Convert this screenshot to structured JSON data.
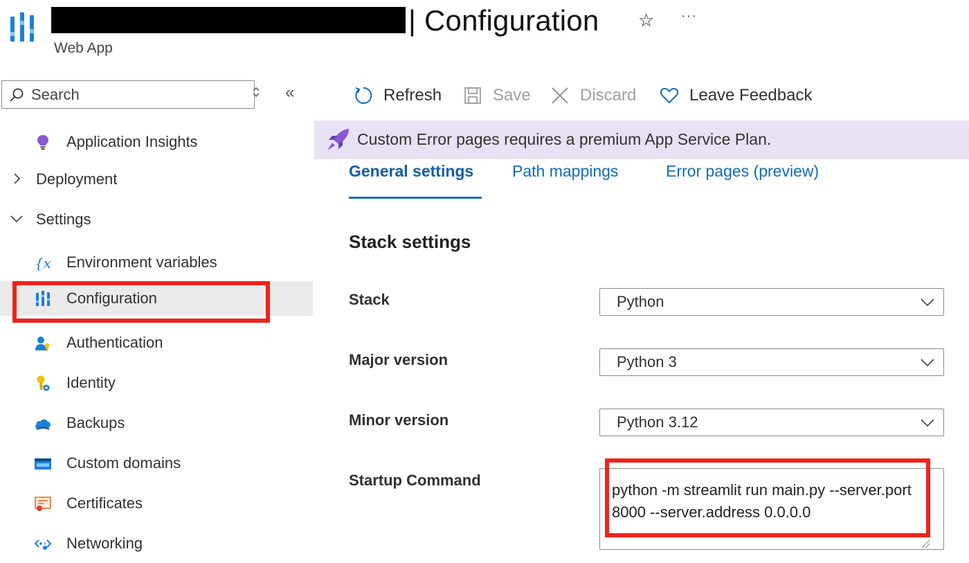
{
  "header": {
    "title": "| Configuration",
    "subtitle": "Web App",
    "favorite_icon": "star-icon",
    "more_icon": "ellipsis-icon"
  },
  "sidebar": {
    "search_placeholder": "Search",
    "items": [
      {
        "label": "Application Insights",
        "icon": "lightbulb-icon"
      },
      {
        "label": "Deployment",
        "icon": "chevron-right-icon"
      },
      {
        "label": "Settings",
        "icon": "chevron-down-icon"
      },
      {
        "label": "Environment variables",
        "icon": "variable-icon"
      },
      {
        "label": "Configuration",
        "icon": "configuration-icon",
        "selected": true
      },
      {
        "label": "Authentication",
        "icon": "user-key-icon"
      },
      {
        "label": "Identity",
        "icon": "identity-key-icon"
      },
      {
        "label": "Backups",
        "icon": "cloud-backup-icon"
      },
      {
        "label": "Custom domains",
        "icon": "www-icon"
      },
      {
        "label": "Certificates",
        "icon": "certificate-icon"
      },
      {
        "label": "Networking",
        "icon": "networking-icon"
      }
    ]
  },
  "toolbar": {
    "refresh": "Refresh",
    "save": "Save",
    "discard": "Discard",
    "feedback": "Leave Feedback"
  },
  "banner": {
    "text": "Custom Error pages requires a premium App Service Plan."
  },
  "tabs": [
    {
      "label": "General settings",
      "active": true
    },
    {
      "label": "Path mappings"
    },
    {
      "label": "Error pages (preview)"
    }
  ],
  "form": {
    "section_title": "Stack settings",
    "stack_label": "Stack",
    "stack_value": "Python",
    "major_label": "Major version",
    "major_value": "Python 3",
    "minor_label": "Minor version",
    "minor_value": "Python 3.12",
    "startup_label": "Startup Command",
    "startup_value": "python -m streamlit run main.py --server.port 8000 --server.address 0.0.0.0"
  },
  "colors": {
    "accent": "#0f6cbd",
    "banner_bg": "#e8e1f3",
    "highlight": "#f0231a",
    "selected_bg": "#eaeaea"
  }
}
